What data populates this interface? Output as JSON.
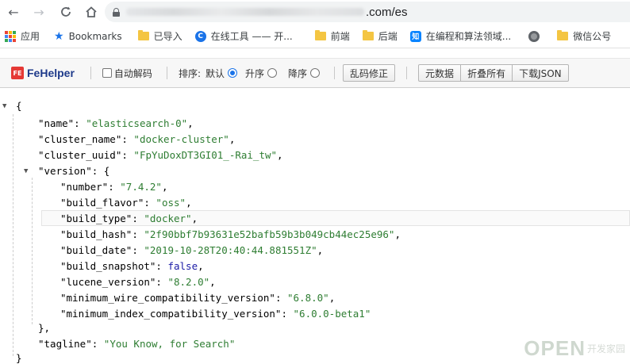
{
  "browser": {
    "url_suffix": ".com/es"
  },
  "bookmarks": [
    {
      "icon": "apps-grid-icon",
      "label": "应用"
    },
    {
      "icon": "star-icon",
      "label": "Bookmarks"
    },
    {
      "icon": "folder-icon",
      "label": "已导入"
    },
    {
      "icon": "c-logo-icon",
      "label": "在线工具 —— 开..."
    },
    {
      "icon": "folder-icon",
      "label": "前端"
    },
    {
      "icon": "folder-icon",
      "label": "后端"
    },
    {
      "icon": "zhihu-icon",
      "label": "在编程和算法领域..."
    },
    {
      "icon": "globe-icon",
      "label": ""
    },
    {
      "icon": "folder-icon",
      "label": "微信公号"
    }
  ],
  "fehelper": {
    "logo_badge": "FE",
    "name": "FeHelper",
    "auto_decode": "自动解码",
    "sort_label": "排序:",
    "sort_default": "默认",
    "sort_asc": "升序",
    "sort_desc": "降序",
    "fix_garbled": "乱码修正",
    "raw_data": "元数据",
    "collapse_all": "折叠所有",
    "download_json": "下载JSON"
  },
  "json": {
    "open_brace": "{",
    "close_brace": "}",
    "close_obj": "},",
    "name_key": "\"name\"",
    "name_val": "\"elasticsearch-0\"",
    "cluster_name_key": "\"cluster_name\"",
    "cluster_name_val": "\"docker-cluster\"",
    "cluster_uuid_key": "\"cluster_uuid\"",
    "cluster_uuid_val": "\"FpYuDoxDT3GI01_-Rai_tw\"",
    "version_key": "\"version\"",
    "number_key": "\"number\"",
    "number_val": "\"7.4.2\"",
    "build_flavor_key": "\"build_flavor\"",
    "build_flavor_val": "\"oss\"",
    "build_type_key": "\"build_type\"",
    "build_type_val": "\"docker\"",
    "build_hash_key": "\"build_hash\"",
    "build_hash_val": "\"2f90bbf7b93631e52bafb59b3b049cb44ec25e96\"",
    "build_date_key": "\"build_date\"",
    "build_date_val": "\"2019-10-28T20:40:44.881551Z\"",
    "build_snapshot_key": "\"build_snapshot\"",
    "build_snapshot_val": "false",
    "lucene_version_key": "\"lucene_version\"",
    "lucene_version_val": "\"8.2.0\"",
    "min_wire_key": "\"minimum_wire_compatibility_version\"",
    "min_wire_val": "\"6.8.0\"",
    "min_index_key": "\"minimum_index_compatibility_version\"",
    "min_index_val": "\"6.0.0-beta1\"",
    "tagline_key": "\"tagline\"",
    "tagline_val": "\"You Know, for Search\""
  },
  "watermark": {
    "open": "OPEN",
    "cn": "开发家园"
  }
}
